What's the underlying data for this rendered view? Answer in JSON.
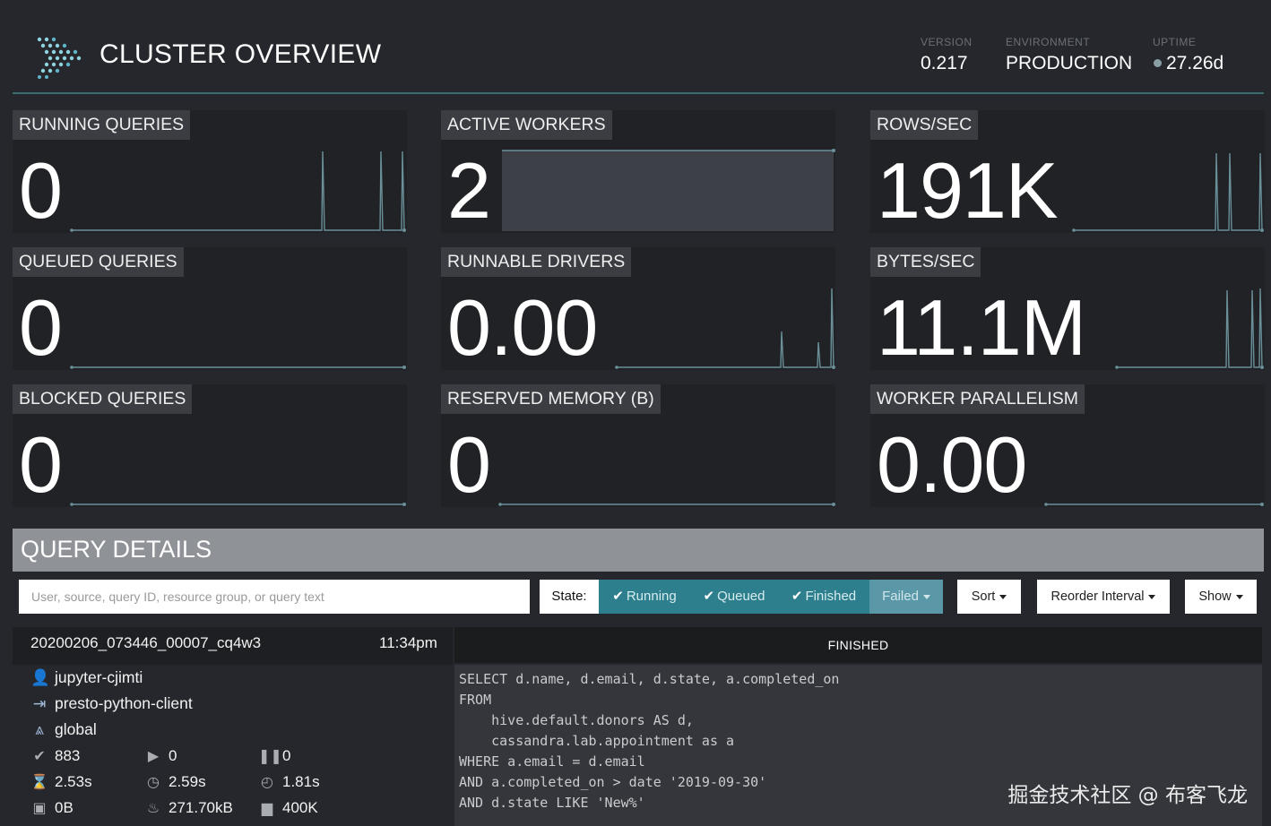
{
  "header": {
    "title": "CLUSTER OVERVIEW",
    "version_label": "VERSION",
    "version_value": "0.217",
    "environment_label": "ENVIRONMENT",
    "environment_value": "PRODUCTION",
    "uptime_label": "UPTIME",
    "uptime_value": "27.26d"
  },
  "cards": [
    {
      "label": "RUNNING QUERIES",
      "value": "0"
    },
    {
      "label": "ACTIVE WORKERS",
      "value": "2"
    },
    {
      "label": "ROWS/SEC",
      "value": "191K"
    },
    {
      "label": "QUEUED QUERIES",
      "value": "0"
    },
    {
      "label": "RUNNABLE DRIVERS",
      "value": "0.00"
    },
    {
      "label": "BYTES/SEC",
      "value": "11.1M"
    },
    {
      "label": "BLOCKED QUERIES",
      "value": "0"
    },
    {
      "label": "RESERVED MEMORY (B)",
      "value": "0"
    },
    {
      "label": "WORKER PARALLELISM",
      "value": "0.00"
    }
  ],
  "query_details": {
    "title": "QUERY DETAILS",
    "search_placeholder": "User, source, query ID, resource group, or query text",
    "state_label": "State:",
    "state_running": "Running",
    "state_queued": "Queued",
    "state_finished": "Finished",
    "state_failed": "Failed",
    "sort_label": "Sort",
    "reorder_label": "Reorder Interval",
    "show_label": "Show"
  },
  "query": {
    "id": "20200206_073446_00007_cq4w3",
    "time": "11:34pm",
    "status": "FINISHED",
    "user": "jupyter-cjimti",
    "source": "presto-python-client",
    "resource_group": "global",
    "completed_splits": "883",
    "running_splits": "0",
    "queued_splits": "0",
    "wall_time": "2.53s",
    "elapsed_time": "2.59s",
    "cpu_time": "1.81s",
    "memory": "0B",
    "bytes": "271.70kB",
    "rows": "400K",
    "sql": "SELECT d.name, d.email, d.state, a.completed_on\nFROM\n    hive.default.donors AS d,\n    cassandra.lab.appointment as a\nWHERE a.email = d.email\nAND a.completed_on > date '2019-09-30'\nAND d.state LIKE 'New%'"
  },
  "watermark": "掘金技术社区 @ 布客飞龙",
  "colors": {
    "background": "#25272c",
    "card": "#202226",
    "accent": "#2d7f8d",
    "spark": "#6a8f98"
  }
}
